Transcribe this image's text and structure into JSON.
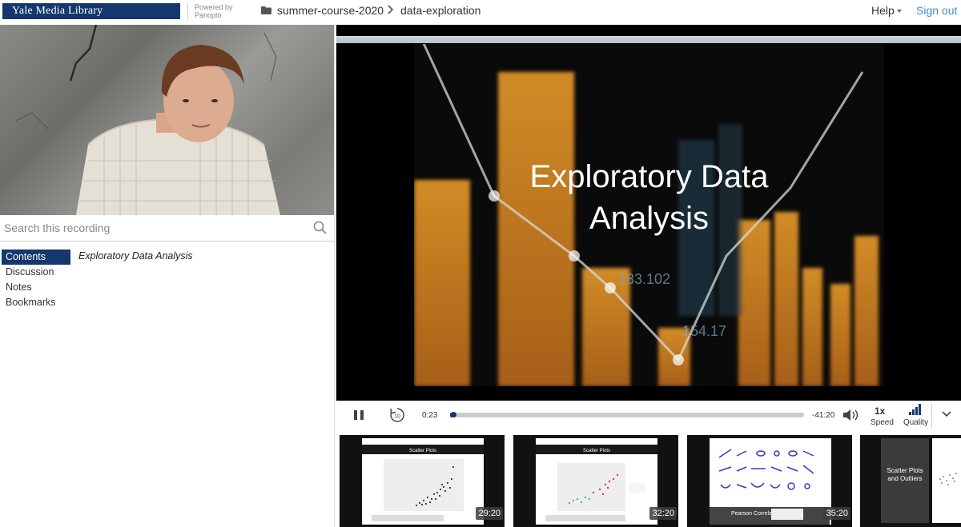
{
  "header": {
    "logo_text": "Yale Media Library",
    "powered_by_line1": "Powered by",
    "powered_by_line2": "Panopto",
    "breadcrumb_folder": "summer-course-2020",
    "breadcrumb_session": "data-exploration",
    "help_label": "Help",
    "signout_label": "Sign out",
    "accent_color": "#14376d",
    "link_color": "#3b8fd0"
  },
  "sidebar": {
    "search_placeholder": "Search this recording",
    "tabs": [
      {
        "label": "Contents",
        "active": true
      },
      {
        "label": "Discussion",
        "active": false
      },
      {
        "label": "Notes",
        "active": false
      },
      {
        "label": "Bookmarks",
        "active": false
      }
    ],
    "contents_items": [
      "Exploratory Data Analysis"
    ]
  },
  "video": {
    "slide_title_line1": "Exploratory Data",
    "slide_title_line2": "Analysis",
    "bg_label_1": "183.102",
    "bg_label_2": "154.17"
  },
  "controls": {
    "current_time": "0:23",
    "remaining_time": "-41:20",
    "progress_fraction": 0.009,
    "speed_value": "1x",
    "speed_label": "Speed",
    "quality_label": "Quality"
  },
  "thumbnails": [
    {
      "time": "29:20",
      "slide_title": "Scatter Plots"
    },
    {
      "time": "32:20",
      "slide_title": "Scatter Plots"
    },
    {
      "time": "35:20",
      "slide_title": "Pearson Correlation"
    },
    {
      "time": "",
      "slide_title": "Scatter Plots and Outliers"
    }
  ]
}
